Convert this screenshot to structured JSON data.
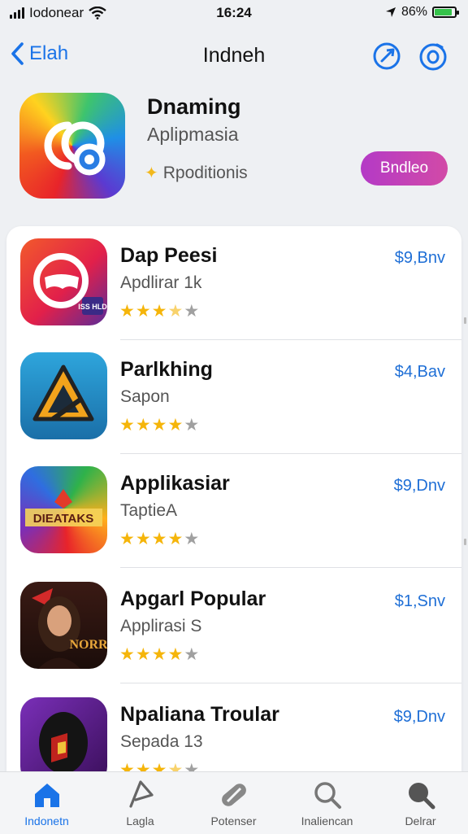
{
  "status_bar": {
    "carrier": "Iodonear",
    "time": "16:24",
    "battery": "86%",
    "battery_level": 0.86
  },
  "nav": {
    "back_label": "Elah",
    "title": "Indneh"
  },
  "featured": {
    "title": "Dnaming",
    "subtitle": "Aplipmasia",
    "badge": "Rpoditionis",
    "button_label": "Bndleo"
  },
  "apps": [
    {
      "name": "Dap Peesi",
      "category": "Apdlirar 1k",
      "price": "$9,Bnv",
      "rating": 3.5
    },
    {
      "name": "Parlkhing",
      "category": "Sapon",
      "price": "$4,Bav",
      "rating": 4
    },
    {
      "name": "Applikasiar",
      "category": "TaptieA",
      "price": "$9,Dnv",
      "rating": 4
    },
    {
      "name": "Apgarl Popular",
      "category": "Applirasi S",
      "price": "$1,Snv",
      "rating": 4
    },
    {
      "name": "Npaliana Troular",
      "category": "Sepada 13",
      "price": "$9,Dnv",
      "rating": 3.5
    }
  ],
  "icon_texts": {
    "app1": "ISS HLD",
    "app3": "DIEATAKS",
    "app4": "NORR"
  },
  "tabs": [
    {
      "label": "Indonetn",
      "icon": "home-icon"
    },
    {
      "label": "Lagla",
      "icon": "play-icon"
    },
    {
      "label": "Potenser",
      "icon": "capsule-icon"
    },
    {
      "label": "Inaliencan",
      "icon": "search-icon"
    },
    {
      "label": "Delrar",
      "icon": "magnifier-icon"
    }
  ],
  "colors": {
    "accent": "#1a73e8",
    "button": "#c042b8",
    "star": "#f5b50a",
    "battery": "#35c24a"
  }
}
